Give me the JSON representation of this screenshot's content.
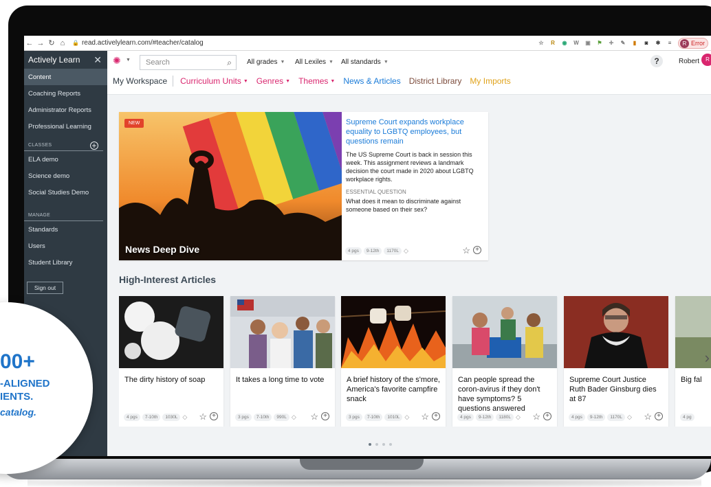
{
  "browser": {
    "url": "read.activelylearn.com/#teacher/catalog",
    "profile_initial": "R",
    "error_label": "Error"
  },
  "sidebar": {
    "title": "Actively Learn",
    "items": [
      "Content",
      "Coaching Reports",
      "Administrator Reports",
      "Professional Learning"
    ],
    "classes_label": "CLASSES",
    "classes": [
      "ELA demo",
      "Science demo",
      "Social Studies Demo"
    ],
    "manage_label": "MANAGE",
    "manage": [
      "Standards",
      "Users",
      "Student Library"
    ],
    "signout": "Sign out"
  },
  "toolbar": {
    "search_placeholder": "Search",
    "filters": [
      "All grades",
      "All Lexiles",
      "All standards"
    ],
    "help": "?",
    "user": "Robert",
    "user_initial": "R"
  },
  "nav": {
    "workspace": "My Workspace",
    "curriculum": "Curriculum Units",
    "genres": "Genres",
    "themes": "Themes",
    "news": "News & Articles",
    "district": "District Library",
    "imports": "My Imports"
  },
  "colors": {
    "workspace": "#2f3a43",
    "curriculum": "#d9266e",
    "genres": "#d9266e",
    "themes": "#d9266e",
    "news": "#1a7bd8",
    "district": "#7b4a3a",
    "imports": "#e0a21a",
    "promo": "#1f74c9"
  },
  "feature": {
    "badge": "NEW",
    "label": "News Deep Dive",
    "title": "Supreme Court expands workplace equality to LGBTQ employees, but questions remain",
    "description": "The US Supreme Court is back in session this week. This assignment reviews a landmark decision the court made in 2020 about LGBTQ workplace rights.",
    "eq_label": "ESSENTIAL QUESTION",
    "eq": "What does it mean to discriminate against someone based on their sex?",
    "pages": "4 pgs",
    "grades": "9-12th",
    "lexile": "1170L"
  },
  "section_title": "High-Interest Articles",
  "cards": [
    {
      "title": "The dirty history of soap",
      "pages": "4 pgs",
      "grades": "7-10th",
      "lexile": "1030L"
    },
    {
      "title": "It takes a long time to vote",
      "pages": "3 pgs",
      "grades": "7-10th",
      "lexile": "990L"
    },
    {
      "title": "A brief history of the s'more, America's favorite campfire snack",
      "pages": "3 pgs",
      "grades": "7-10th",
      "lexile": "1010L"
    },
    {
      "title": "Can people spread the coron-avirus if they don't have symptoms? 5 questions answered",
      "pages": "4 pgs",
      "grades": "9-12th",
      "lexile": "1180L"
    },
    {
      "title": "Supreme Court Justice Ruth Bader Ginsburg dies at 87",
      "pages": "4 pgs",
      "grades": "9-12th",
      "lexile": "1170L"
    },
    {
      "title": "Big fal",
      "pages": "4 pg",
      "grades": "",
      "lexile": ""
    }
  ],
  "promo": {
    "big": "00+",
    "line1": "-ALIGNED",
    "line2": "IENTS.",
    "line3": "catalog."
  }
}
